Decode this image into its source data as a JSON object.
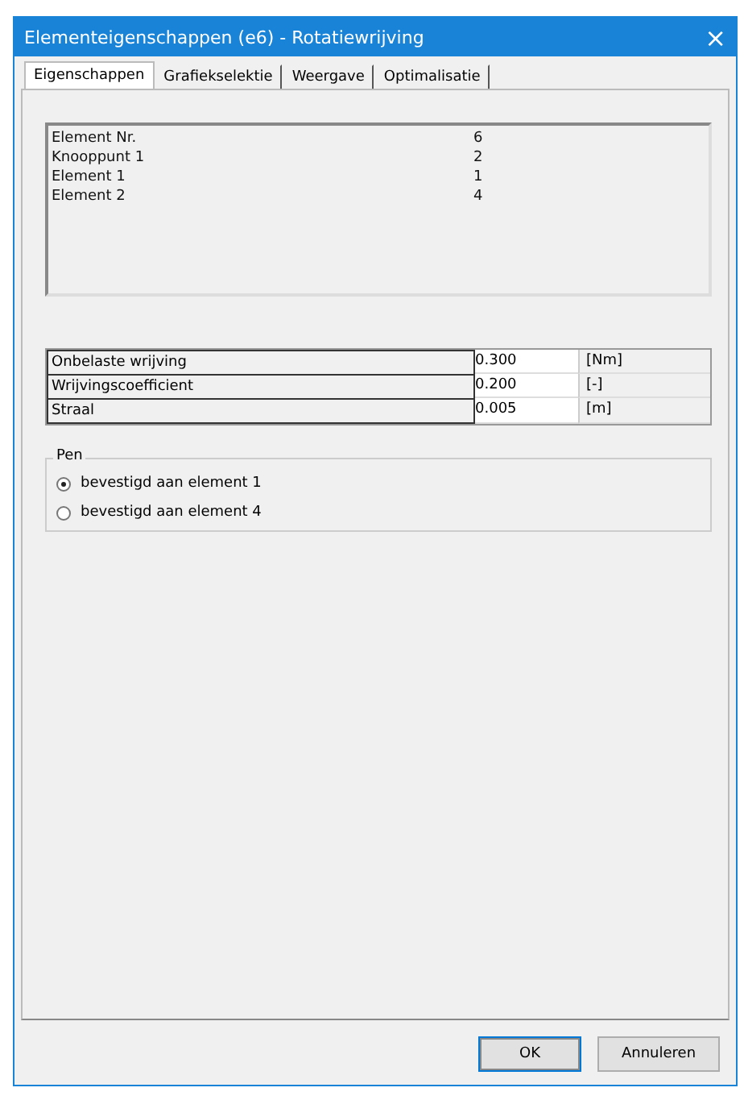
{
  "window": {
    "title": "Elementeigenschappen (e6) - Rotatiewrijving",
    "close": "×"
  },
  "tabs": [
    {
      "label": "Eigenschappen",
      "selected": true
    },
    {
      "label": "Grafiekselektie",
      "selected": false
    },
    {
      "label": "Weergave",
      "selected": false
    },
    {
      "label": "Optimalisatie",
      "selected": false
    }
  ],
  "info": [
    {
      "label": "Element Nr.",
      "value": "6"
    },
    {
      "label": "Knooppunt 1",
      "value": "2"
    },
    {
      "label": "Element 1",
      "value": "1"
    },
    {
      "label": "Element 2",
      "value": "4"
    }
  ],
  "properties": [
    {
      "label": "Onbelaste wrijving",
      "value": "0.300",
      "unit": "[Nm]"
    },
    {
      "label": "Wrijvingscoefficient",
      "value": "0.200",
      "unit": "[-]"
    },
    {
      "label": "Straal",
      "value": "0.005",
      "unit": "[m]"
    }
  ],
  "pen": {
    "title": "Pen",
    "options": [
      {
        "label": "bevestigd aan element 1",
        "selected": true
      },
      {
        "label": "bevestigd aan element 4",
        "selected": false
      }
    ]
  },
  "buttons": [
    {
      "label": "OK",
      "default": true
    },
    {
      "label": "Annuleren",
      "default": false
    }
  ]
}
